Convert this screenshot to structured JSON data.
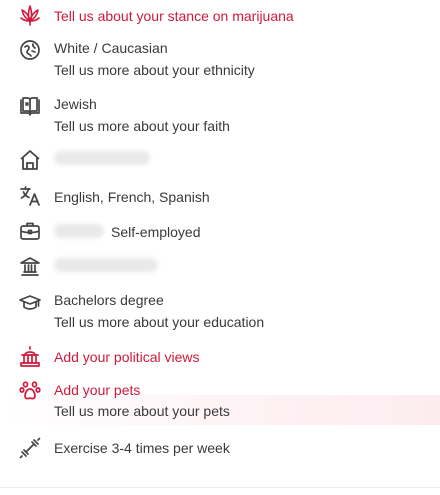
{
  "colors": {
    "accent": "#d11a3b",
    "text": "#3a3a3a",
    "icon": "#444444"
  },
  "items": [
    {
      "icon": "cannabis-icon",
      "label": "Tell us about your stance on marijuana"
    },
    {
      "icon": "ethnicity-icon",
      "value": "White / Caucasian",
      "prompt": "Tell us more about your ethnicity"
    },
    {
      "icon": "faith-book-icon",
      "value": "Jewish",
      "prompt": "Tell us more about your faith"
    },
    {
      "icon": "hometown-icon"
    },
    {
      "icon": "language-icon",
      "value": "English, French, Spanish"
    },
    {
      "icon": "briefcase-icon",
      "value": "Self-employed"
    },
    {
      "icon": "school-icon"
    },
    {
      "icon": "graduation-cap-icon",
      "value": "Bachelors degree",
      "prompt": "Tell us more about your education"
    },
    {
      "icon": "capitol-icon",
      "label": "Add your political views"
    },
    {
      "icon": "paw-icon",
      "label": "Add your pets",
      "prompt": "Tell us more about your pets"
    },
    {
      "icon": "dumbbell-icon",
      "value": "Exercise 3-4 times per week"
    }
  ]
}
